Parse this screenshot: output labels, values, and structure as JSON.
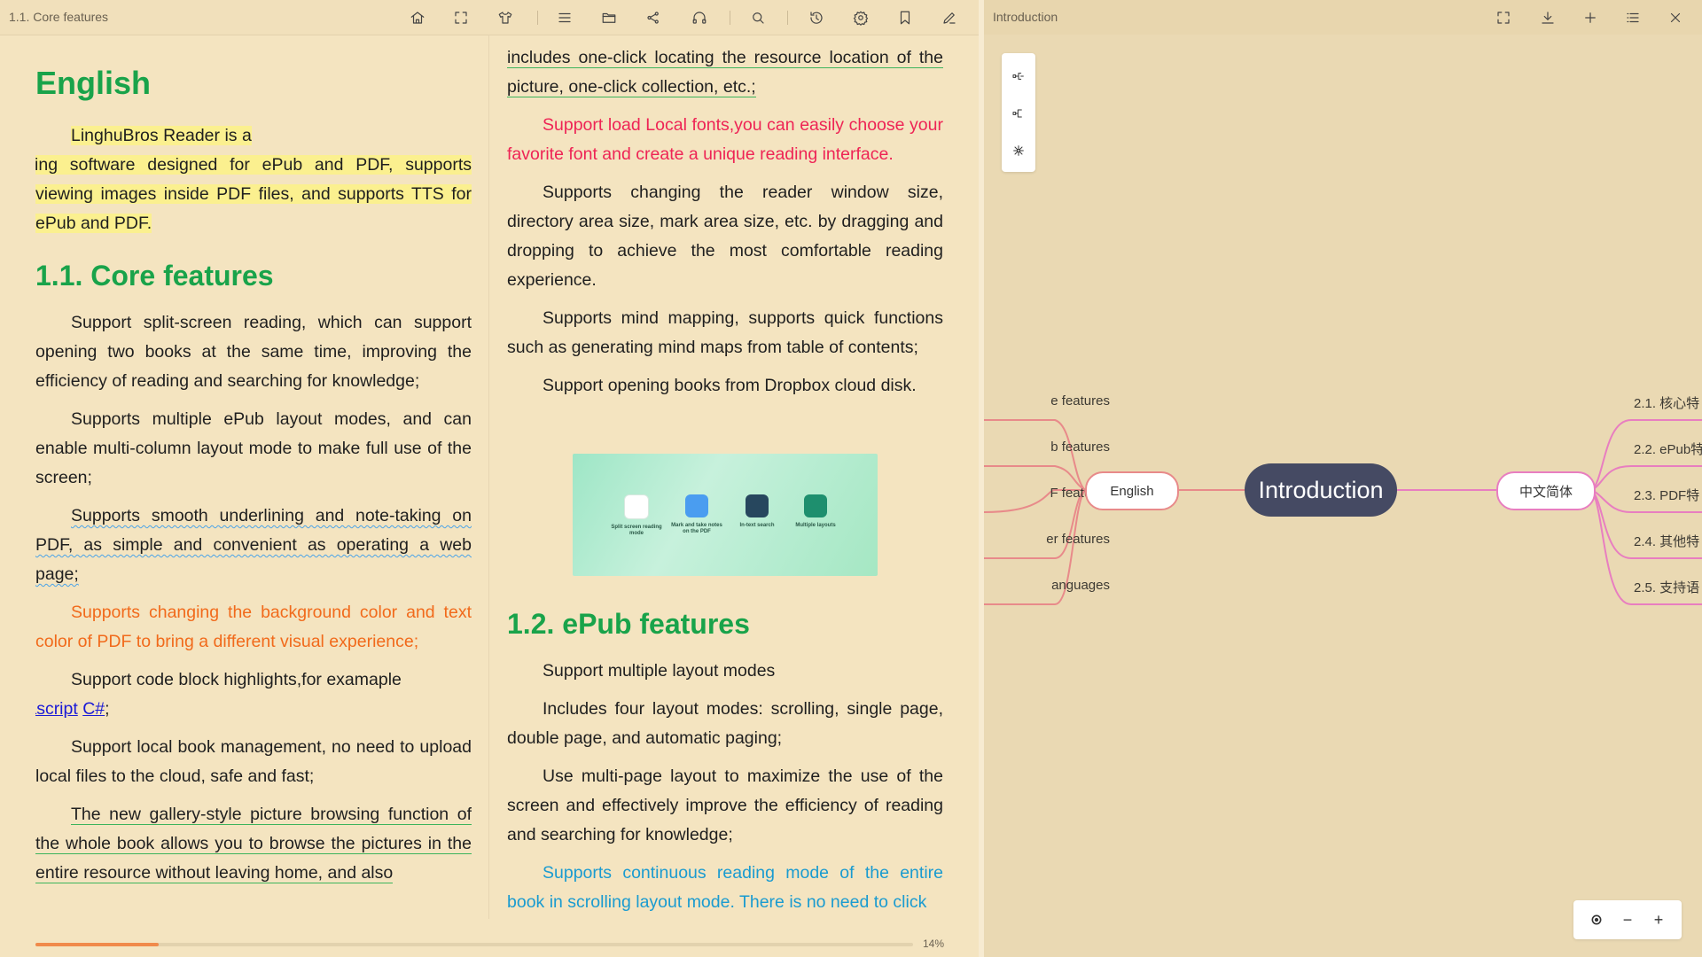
{
  "reader": {
    "title": "1.1. Core features",
    "progress_percent": 14,
    "progress_label": "14%",
    "left": {
      "h1": "English",
      "intro_a": "LinghuBros Reader is a ",
      "intro_b": "reading software designed for ePub and PDF, supports viewing images inside PDF files, and supports TTS for ePub and PDF.",
      "h2": "1.1. Core features",
      "p1": "Support split-screen reading, which can support opening two books at the same time, improving the efficiency of reading and searching for knowledge;",
      "p2": "Supports multiple ePub layout modes, and can enable multi-column layout mode to make full use of the screen;",
      "p3": "Supports smooth underlining and note-taking on PDF, as simple and convenient as operating a web page;",
      "p4": "Supports changing the background color and text color of PDF to bring a different visual experience;",
      "p5": "Support code block highlights,for examaple",
      "link_js": "Javascript",
      "link_cs": "C#",
      "p5_end": ";",
      "p6": "Support local book management, no need to upload local files to the cloud, safe and fast;",
      "p7": "The new gallery-style picture browsing function of the whole book allows you to browse the pictures in the entire resource without leaving home, and also"
    },
    "right": {
      "p1": "includes one-click locating the resource location of the picture, one-click collection, etc.;",
      "p2": "Support load Local fonts,you can easily choose your favorite font and create a unique reading interface.",
      "p3": "Supports changing the reader window size, directory area size, mark area size, etc. by dragging and dropping to achieve the most comfortable reading experience.",
      "p4": "Supports mind mapping, supports quick functions such as generating mind maps from table of contents;",
      "p5": "Support opening books from Dropbox cloud disk.",
      "image_labels": [
        "Split screen reading mode",
        "Mark and take notes on the PDF",
        "In-text search",
        "Multiple layouts"
      ],
      "h2": "1.2. ePub features",
      "p6": "Support multiple layout modes",
      "p7": "Includes four layout modes: scrolling, single page, double page, and automatic paging;",
      "p8": "Use multi-page layout to maximize the use of the screen and effectively improve the efficiency of reading and searching for knowledge;",
      "p9": "Supports continuous reading mode of the entire book in scrolling layout mode. There is no need to click"
    },
    "toolbar_icons": [
      "home-icon",
      "fullscreen-icon",
      "shirt-icon",
      "menu-icon",
      "folder-icon",
      "share-icon",
      "headphones-icon",
      "search-icon",
      "history-icon",
      "settings-icon",
      "bookmark-icon",
      "edit-icon"
    ]
  },
  "mindmap": {
    "title": "Introduction",
    "root": "Introduction",
    "english": "English",
    "chinese": "中文简体",
    "left_leaves": [
      "e features",
      "b features",
      "F features",
      "er features",
      "anguages"
    ],
    "right_leaves": [
      "2.1. 核心特",
      "2.2. ePub特",
      "2.3. PDF特",
      "2.4. 其他特",
      "2.5. 支持语"
    ],
    "toolbar_icons": [
      "fullscreen-icon",
      "download-icon",
      "plus-icon",
      "list-icon",
      "close-icon"
    ],
    "colors": {
      "root_bg": "#454a63",
      "left_branch": "#e88a8a",
      "right_branch": "#e87ec0"
    }
  }
}
